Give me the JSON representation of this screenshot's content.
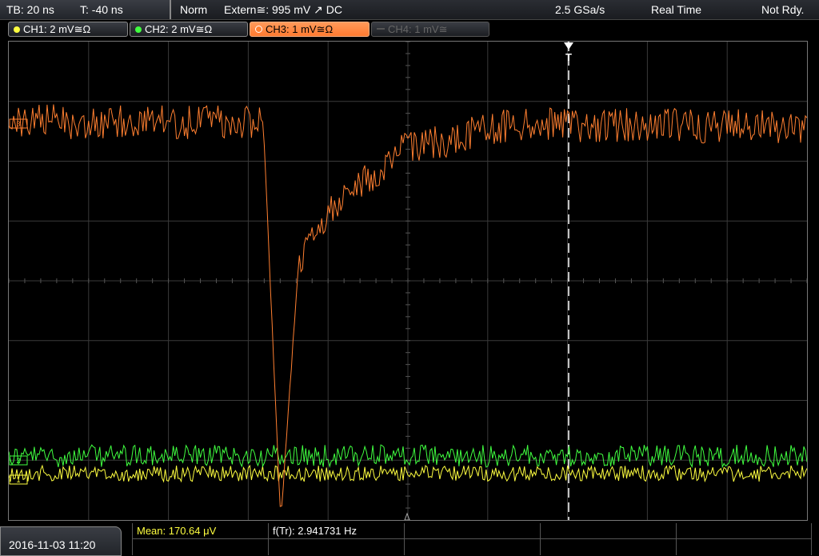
{
  "status": {
    "timebase": "TB: 20 ns",
    "trigger_time": "T: -40 ns",
    "trigger_mode": "Norm",
    "trigger_source": "Extern≅: 995 mV ↗ DC",
    "sample_rate": "2.5 GSa/s",
    "acq_mode": "Real Time",
    "run_state": "Not Rdy."
  },
  "channels": [
    {
      "label": "CH1: 2 mV≅Ω",
      "color": "#ffff40",
      "active": true
    },
    {
      "label": "CH2: 2 mV≅Ω",
      "color": "#40ff40",
      "active": true
    },
    {
      "label": "CH3: 1 mV≅Ω",
      "color": "#ff7f30",
      "active": true,
      "selected": true
    },
    {
      "label": "CH4: 1 mV≅",
      "color": "#666666",
      "active": false
    }
  ],
  "markers": {
    "ch3": "3",
    "ch2": "2",
    "ch1": "1",
    "trigger": "T"
  },
  "measurements": {
    "mean": "Mean: 170.64 μV",
    "freq": "f(Tr): 2.941731 Hz"
  },
  "datetime": "2016-11-03 11:20",
  "colors": {
    "ch1": "#ffff40",
    "ch2": "#40ff40",
    "ch3": "#ff7f30",
    "grid": "#3a3a3a",
    "trigger_line": "#ffffff"
  }
}
